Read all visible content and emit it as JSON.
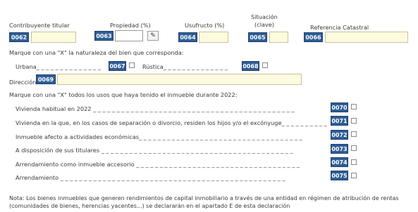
{
  "header": {
    "contribuyente_label": "Contribuyente titular",
    "propiedad_label": "Propiedad (%)",
    "usufructo_label": "Usufructo (%)",
    "situacion_label_1": "Situación",
    "situacion_label_2": "(clave)",
    "referencia_label": "Referencia Catastral"
  },
  "codes": {
    "c0062": "0062",
    "c0063": "0063",
    "c0064": "0064",
    "c0065": "0065",
    "c0066": "0066",
    "c0067": "0067",
    "c0068": "0068",
    "c0069": "0069",
    "c0070": "0070",
    "c0071": "0071",
    "c0072": "0072",
    "c0073": "0073",
    "c0074": "0074",
    "c0075": "0075"
  },
  "fields": {
    "contribuyente_value": "",
    "propiedad_value": "",
    "usufructo_value": "",
    "situacion_value": "",
    "referencia_value": "",
    "direccion_value": ""
  },
  "naturaleza": {
    "prompt": "Marque con una \"X\" la naturaleza del bien que corresponda:",
    "urbana_label": "Urbana_ _ _ _ _ _ _ _ _ _ _ _ _ _",
    "rustica_label": "Rústica_ _ _ _ _ _ _ _ _ _ _ _ _ _"
  },
  "direccion_label": "Dirección",
  "usos": {
    "prompt": "Marque con una \"X\" todos los usos que haya tenido el inmueble durante 2022:",
    "items": [
      "Vivienda habitual en 2022 _ _ _ _ _ _ _ _ _ _ _ _ _ _ _ _ _ _ _ _ _ _ _ _ _ _ _ _ _ _ _ _ _ _ _ _ _ _ _ _ _ _ _",
      "Vivienda en la que, en los casos de separación o divorcio, residen los hijos y/o el excónyuge_ _ _ _ _ _ _ _ _ _",
      "Inmueble afecto a actividades económicas_ _ _ _ _ _ _ _ _ _ _ _ _ _ _ _ _ _ _ _ _ _ _ _ _ _ _ _ _ _ _ _ _ _ _",
      "A disposición de sus titulares _ _ _ _ _ _ _ _ _ _ _ _ _ _ _ _ _ _ _ _ _ _ _ _ _ _ _ _ _ _ _ _ _ _ _ _ _ _ _ _ _",
      "Arrendamiento como inmueble accesorio _ _ _ _ _ _ _ _ _ _ _ _ _ _ _ _ _ _ _ _ _ _ _ _ _ _ _ _ _ _ _ _ _ _ _",
      "Arrendamiento _ _ _ _ _ _ _ _ _ _ _ _ _ _ _ _ _ _ _ _ _ _ _ _ _ _ _ _ _ _ _ _ _ _ _ _ _ _ _ _ _ _ _ _ _ _ _ _"
    ]
  },
  "note": "Nota: Los bienes inmuebles que generen rendimientos de capital inmobiliario a través de una entidad en régimen de atribución de rentas (comunidades de bienes, herencias yacentes...) se declararán en el apartado E de esta declaración"
}
